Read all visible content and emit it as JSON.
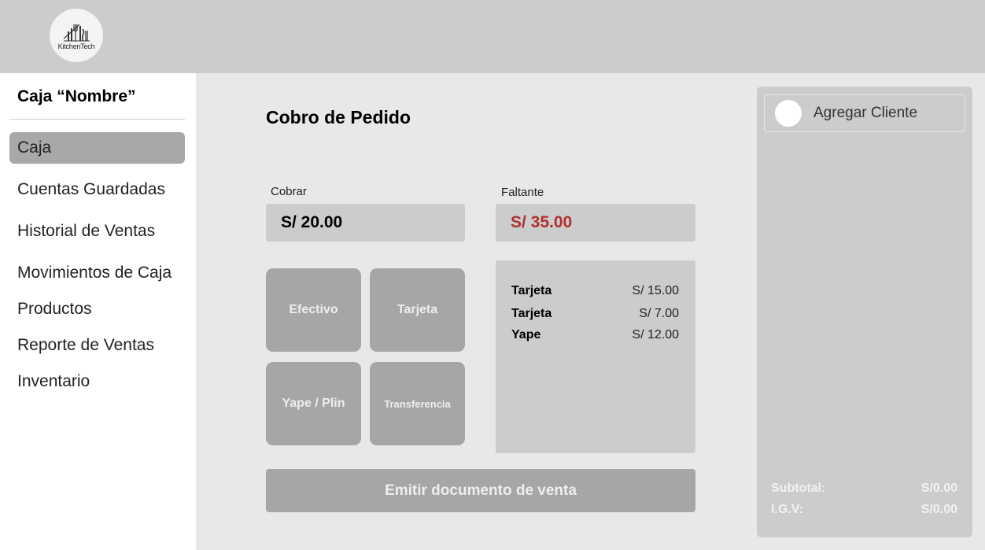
{
  "header": {
    "logo_text": "KitchenTech"
  },
  "sidebar": {
    "title": "Caja “Nombre”",
    "items": [
      {
        "label": "Caja"
      },
      {
        "label": "Cuentas Guardadas"
      },
      {
        "label": "Historial de Ventas"
      },
      {
        "label": "Movimientos de Caja"
      },
      {
        "label": "Productos"
      },
      {
        "label": "Reporte de Ventas"
      },
      {
        "label": "Inventario"
      }
    ]
  },
  "main": {
    "title": "Cobro de Pedido",
    "cobrar_label": "Cobrar",
    "cobrar_value": "S/ 20.00",
    "faltante_label": "Faltante",
    "faltante_value": "S/ 35.00",
    "faltante_color": "#b03030",
    "payment_methods": [
      {
        "label": "Efectivo"
      },
      {
        "label": "Tarjeta"
      },
      {
        "label": "Yape / Plin"
      },
      {
        "label": "Transferencia"
      }
    ],
    "payments": [
      {
        "method": "Tarjeta",
        "amount": "S/ 15.00"
      },
      {
        "method": "Tarjeta",
        "amount": "S/ 7.00"
      },
      {
        "method": "Yape",
        "amount": "S/ 12.00"
      }
    ],
    "emit_label": "Emitir documento de venta"
  },
  "right_panel": {
    "add_client_label": "Agregar Cliente",
    "subtotal_label": "Subtotal:",
    "subtotal_value": "S/0.00",
    "igv_label": "I.G.V:",
    "igv_value": "S/0.00"
  }
}
